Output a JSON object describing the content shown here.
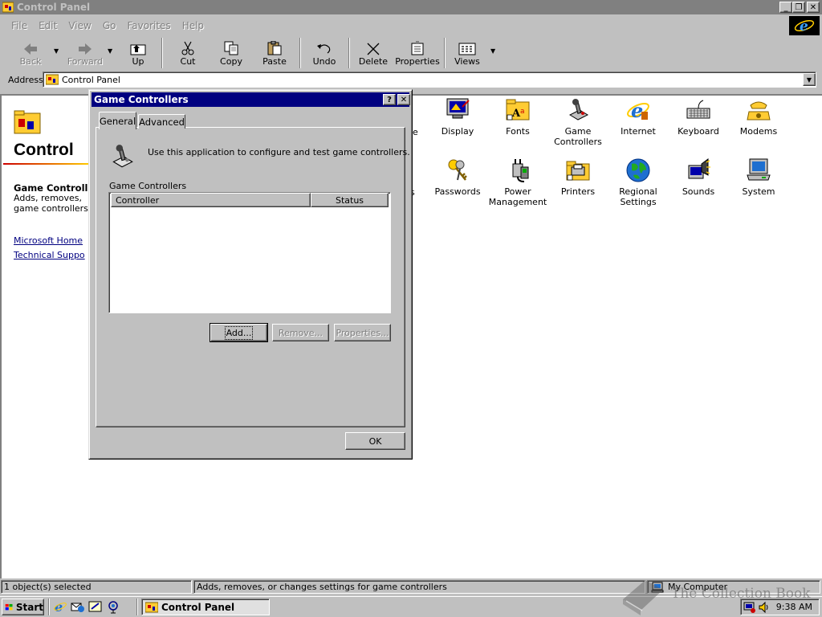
{
  "window": {
    "title": "Control Panel",
    "controls": {
      "minimize": "_",
      "maximize": "❐",
      "close": "✕"
    }
  },
  "menu": [
    "File",
    "Edit",
    "View",
    "Go",
    "Favorites",
    "Help"
  ],
  "toolbar": {
    "back": "Back",
    "forward": "Forward",
    "up": "Up",
    "cut": "Cut",
    "copy": "Copy",
    "paste": "Paste",
    "undo": "Undo",
    "delete": "Delete",
    "properties": "Properties",
    "views": "Views"
  },
  "address": {
    "label": "Address",
    "value": "Control Panel"
  },
  "leftpane": {
    "heading": "Control",
    "selected_title": "Game Controll",
    "selected_desc_lines": [
      "Adds, removes,",
      "game controllers"
    ],
    "links": [
      "Microsoft Home",
      "Technical Suppo"
    ]
  },
  "icons": [
    {
      "label": "Display",
      "icon": "display-icon"
    },
    {
      "label": "Fonts",
      "icon": "fonts-icon"
    },
    {
      "label": "Game Controllers",
      "icon": "joystick-icon"
    },
    {
      "label": "Internet",
      "icon": "internet-explorer-icon"
    },
    {
      "label": "Keyboard",
      "icon": "keyboard-icon"
    },
    {
      "label": "Modems",
      "icon": "modem-icon"
    },
    {
      "label": "Passwords",
      "icon": "keys-icon"
    },
    {
      "label": "Power Management",
      "icon": "power-plug-icon"
    },
    {
      "label": "Printers",
      "icon": "printer-folder-icon"
    },
    {
      "label": "Regional Settings",
      "icon": "globe-icon"
    },
    {
      "label": "Sounds",
      "icon": "speaker-icon"
    },
    {
      "label": "System",
      "icon": "computer-icon"
    }
  ],
  "partial_labels": [
    "e",
    "s"
  ],
  "dialog": {
    "title": "Game Controllers",
    "help_button": "?",
    "close_button": "✕",
    "tabs": [
      "General",
      "Advanced"
    ],
    "active_tab": "General",
    "intro": "Use this application to configure and test game controllers.",
    "list_label": "Game Controllers",
    "columns": [
      "Controller",
      "Status"
    ],
    "rows": [],
    "buttons": {
      "add": "Add...",
      "remove": "Remove...",
      "properties": "Properties...",
      "ok": "OK"
    }
  },
  "statusbar": {
    "count": "1 object(s) selected",
    "message": "Adds, removes, or changes settings for game controllers",
    "zone": "My Computer"
  },
  "taskbar": {
    "start": "Start",
    "task": "Control Panel",
    "clock": "9:38 AM"
  },
  "watermark": "The Collection Book",
  "colors": {
    "title_active": "#000080",
    "title_inactive": "#808080",
    "face": "#c0c0c0",
    "link": "#000080"
  }
}
